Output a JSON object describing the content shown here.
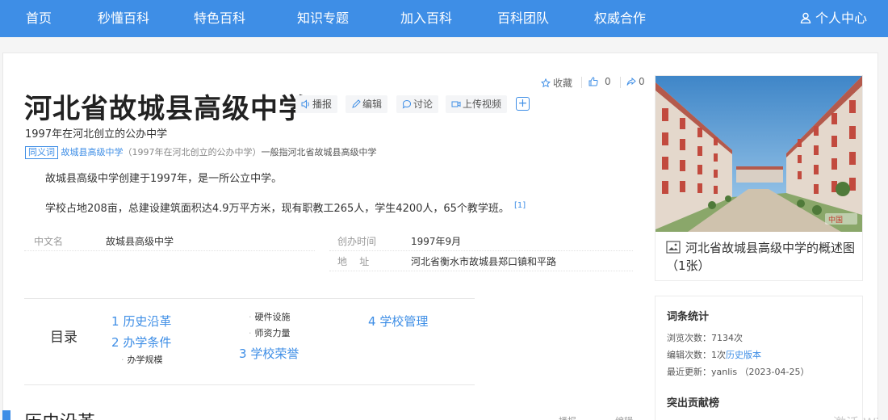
{
  "nav": {
    "items": [
      "首页",
      "秒懂百科",
      "特色百科",
      "知识专题",
      "加入百科",
      "百科团队",
      "权威合作"
    ],
    "user": "个人中心"
  },
  "lemma": {
    "title": "河北省故城县高级中学",
    "tools": [
      "播报",
      "编辑",
      "讨论",
      "上传视频"
    ],
    "plus": "+",
    "social": {
      "collect": "收藏",
      "likes": "0",
      "shares": "0"
    },
    "subtitle": "1997年在河北创立的公办中学",
    "synonym": {
      "tag": "同义词",
      "link": "故城县高级中学",
      "paren": "（1997年在河北创立的公办中学）",
      "rest": "一般指河北省故城县高级中学"
    },
    "paragraphs": [
      "故城县高级中学创建于1997年，是一所公立中学。",
      "学校占地208亩，总建设建筑面积达4.9万平方米，现有职教工265人，学生4200人，65个教学班。"
    ],
    "ref": "[1]",
    "basic_info": {
      "left": {
        "key": "中文名",
        "value": "故城县高级中学"
      },
      "right": [
        {
          "key": "创办时间",
          "value": "1997年9月"
        },
        {
          "key": "地    址",
          "value": "河北省衡水市故城县郑口镇和平路"
        }
      ]
    }
  },
  "toc": {
    "label": "目录",
    "items": [
      {
        "num": "1",
        "text": "历史沿革"
      },
      {
        "num": "2",
        "text": "办学条件"
      },
      {
        "num": "3",
        "text": "学校荣誉"
      },
      {
        "num": "4",
        "text": "学校管理"
      }
    ],
    "subs": [
      "办学规模",
      "硬件设施",
      "师资力量"
    ]
  },
  "album": {
    "caption": "河北省故城县高级中学的概述图（1张）",
    "watermark": "中国"
  },
  "stats": {
    "title": "词条统计",
    "views_label": "浏览次数：",
    "views": "7134次",
    "edits_label": "编辑次数：",
    "edits": "1次",
    "history_link": "历史版本",
    "updated_label": "最近更新：",
    "updated": "yanlis （2023-04-25）",
    "contrib_title": "突出贡献榜"
  },
  "section": {
    "title": "历史沿革",
    "tools": [
      "播报",
      "编辑"
    ]
  },
  "watermark": "激活 Wi",
  "colors": {
    "accent": "#3e8ee6",
    "nav_bg": "#3e8ee6"
  }
}
